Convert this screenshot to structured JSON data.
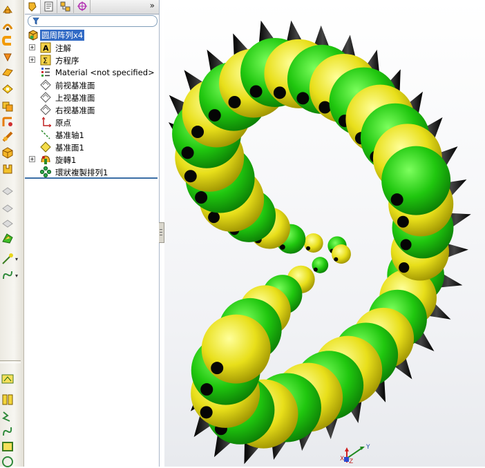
{
  "feature_tree": {
    "filter_icon": "filter-icon",
    "tabs": [
      "featuremanager-tab",
      "propertymanager-tab",
      "configurationmanager-tab",
      "dimxpert-tab"
    ],
    "expand_glyph": "»",
    "items": [
      {
        "label": "圆周阵列x4",
        "icon": "part-icon",
        "expandable": false,
        "selected": true
      },
      {
        "label": "注解",
        "icon": "annotations-icon",
        "expandable": true
      },
      {
        "label": "方程序",
        "icon": "equations-icon",
        "expandable": true
      },
      {
        "label": "Material <not specified>",
        "icon": "material-icon",
        "expandable": false
      },
      {
        "label": "前视基准面",
        "icon": "plane-icon",
        "expandable": false
      },
      {
        "label": "上视基准面",
        "icon": "plane-icon",
        "expandable": false
      },
      {
        "label": "右视基准面",
        "icon": "plane-icon",
        "expandable": false
      },
      {
        "label": "原点",
        "icon": "origin-icon",
        "expandable": false
      },
      {
        "label": "基准轴1",
        "icon": "axis-icon",
        "expandable": false
      },
      {
        "label": "基准面1",
        "icon": "plane1-icon",
        "expandable": false
      },
      {
        "label": "旋轉1",
        "icon": "revolve-icon",
        "expandable": true
      },
      {
        "label": "環狀複製排列1",
        "icon": "circular-pattern-icon",
        "expandable": false
      }
    ]
  },
  "triad": {
    "y_label": "Y",
    "x_label": "X",
    "z_label": "Z"
  },
  "colors": {
    "green": "#22cc11",
    "yellow": "#e9e21e",
    "spike": "#111111",
    "selection": "#316ac5"
  }
}
